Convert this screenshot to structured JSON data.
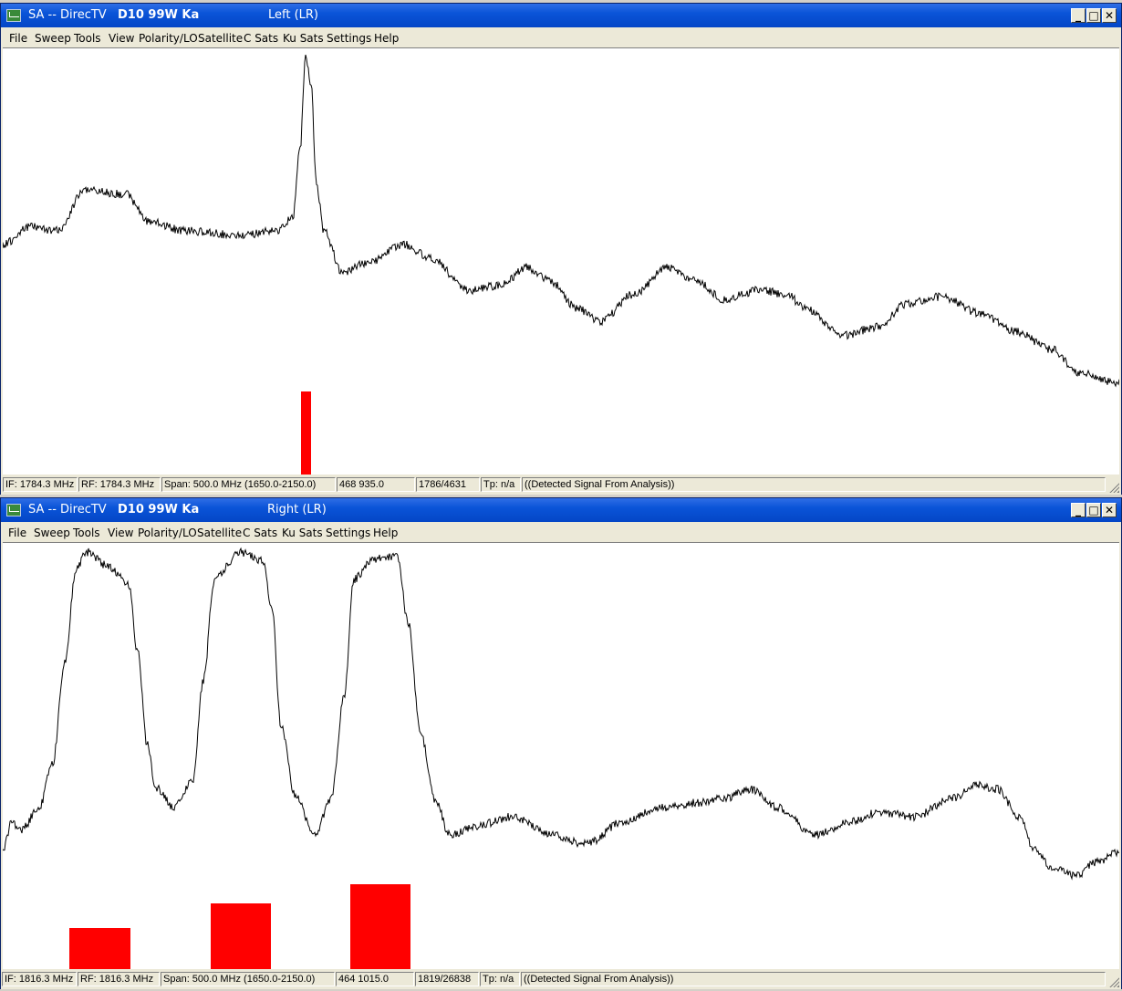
{
  "windows": [
    {
      "title": {
        "app": "SA -- DirecTV",
        "satellite": "D10 99W Ka",
        "polarity": "Left (LR)"
      },
      "menu": [
        "File",
        "Sweep",
        "Tools",
        "View",
        "Polarity/LO",
        "Satellite",
        "C Sats",
        "Ku Sats",
        "Settings",
        "Help"
      ],
      "status": {
        "if": "IF: 1784.3 MHz",
        "rf": "RF: 1784.3 MHz",
        "span": "Span: 500.0 MHz (1650.0-2150.0)",
        "value": "468 935.0",
        "count": "1786/4631",
        "tp": "Tp: n/a",
        "detected": "((Detected Signal From Analysis))"
      }
    },
    {
      "title": {
        "app": "SA -- DirecTV",
        "satellite": "D10 99W Ka",
        "polarity": "Right (LR)"
      },
      "menu": [
        "File",
        "Sweep",
        "Tools",
        "View",
        "Polarity/LO",
        "Satellite",
        "C Sats",
        "Ku Sats",
        "Settings",
        "Help"
      ],
      "status": {
        "if": "IF: 1816.3 MHz",
        "rf": "RF: 1816.3 MHz",
        "span": "Span: 500.0 MHz (1650.0-2150.0)",
        "value": "464 1015.0",
        "count": "1819/26838",
        "tp": "Tp: n/a",
        "detected": "((Detected Signal From Analysis))"
      }
    }
  ],
  "colors": {
    "trace": "#000000",
    "marker": "#ff0000",
    "plot_bg": "#ffffff",
    "titlebar": "#0a54d8"
  },
  "icons": [
    "app-icon",
    "minimize-icon",
    "maximize-icon",
    "close-icon",
    "resize-grip-icon"
  ]
}
